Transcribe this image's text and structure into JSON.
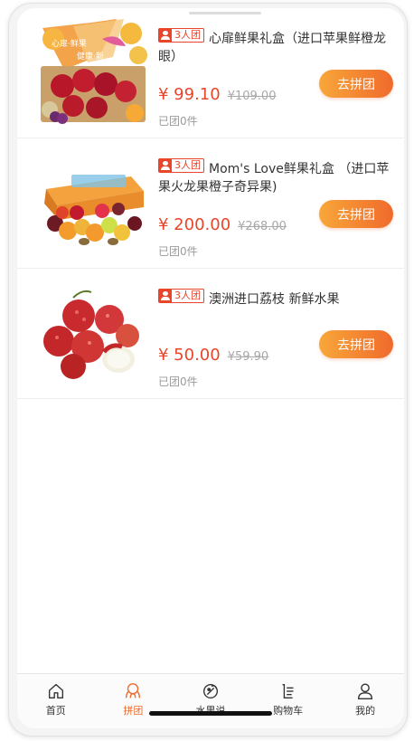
{
  "products": [
    {
      "tag": "3人团",
      "title": "心扉鲜果礼盒（进口苹果鲜橙龙眼）",
      "price": "¥ 99.10",
      "original_price": "¥109.00",
      "sold": "已团0件",
      "button": "去拼团",
      "image": "fruit-gift-box-apples-oranges"
    },
    {
      "tag": "3人团",
      "title": "Mom's Love鲜果礼盒 （进口苹果火龙果橙子奇异果)",
      "price": "¥ 200.00",
      "original_price": "¥268.00",
      "sold": "已团0件",
      "button": "去拼团",
      "image": "fruit-gift-box-mixed"
    },
    {
      "tag": "3人团",
      "title": "澳洲进口荔枝 新鲜水果",
      "price": "¥ 50.00",
      "original_price": "¥59.90",
      "sold": "已团0件",
      "button": "去拼团",
      "image": "lychee"
    }
  ],
  "tabbar": [
    {
      "label": "首页",
      "icon": "home-icon",
      "active": false
    },
    {
      "label": "拼团",
      "icon": "group-buy-icon",
      "active": true
    },
    {
      "label": "水果说",
      "icon": "fruit-talk-icon",
      "active": false
    },
    {
      "label": "购物车",
      "icon": "cart-icon",
      "active": false
    },
    {
      "label": "我的",
      "icon": "profile-icon",
      "active": false
    }
  ],
  "colors": {
    "accent": "#e8452a",
    "button_start": "#f8a73a",
    "button_end": "#f06a2c"
  }
}
